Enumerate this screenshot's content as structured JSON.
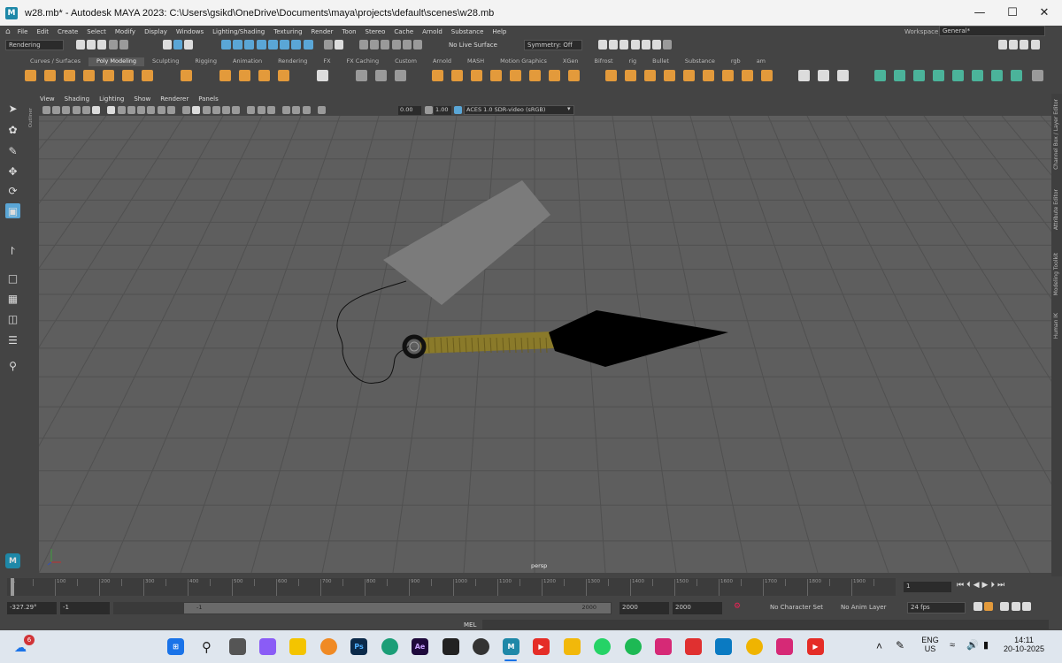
{
  "window": {
    "title": "w28.mb* - Autodesk MAYA 2023: C:\\Users\\gsikd\\OneDrive\\Documents\\maya\\projects\\default\\scenes\\w28.mb",
    "logo": "M"
  },
  "menubar": [
    "File",
    "Edit",
    "Create",
    "Select",
    "Modify",
    "Display",
    "Windows",
    "Lighting/Shading",
    "Texturing",
    "Render",
    "Toon",
    "Stereo",
    "Cache",
    "Arnold",
    "Substance",
    "Help"
  ],
  "workspace": {
    "label": "Workspace:",
    "value": "General*"
  },
  "statusline": {
    "menuset": "Rendering",
    "live_surface": "No Live Surface",
    "symmetry": "Symmetry: Off"
  },
  "shelf": {
    "tabs": [
      "Curves / Surfaces",
      "Poly Modeling",
      "Sculpting",
      "Rigging",
      "Animation",
      "Rendering",
      "FX",
      "FX Caching",
      "Custom",
      "Arnold",
      "MASH",
      "Motion Graphics",
      "XGen",
      "Bifrost",
      "rig",
      "Bullet",
      "Substance",
      "rgb",
      "am"
    ],
    "active": "Poly Modeling"
  },
  "panel": {
    "menus": [
      "View",
      "Shading",
      "Lighting",
      "Show",
      "Renderer",
      "Panels"
    ],
    "exposure": "0.00",
    "gamma": "1.00",
    "colorspace": "ACES 1.0 SDR-video (sRGB)",
    "camera_label": "persp"
  },
  "side_tabs": [
    "Channel Box / Layer Editor",
    "Attribute Editor",
    "Modeling Toolkit",
    "Human IK"
  ],
  "outliner_tab": "Outliner",
  "timeline": {
    "ticks": [
      "1",
      "50",
      "100",
      "150",
      "200",
      "250",
      "300",
      "350",
      "400",
      "450",
      "500",
      "550",
      "600",
      "650",
      "700",
      "750",
      "800",
      "850",
      "900",
      "950",
      "1000",
      "1050",
      "1100",
      "1150",
      "1200",
      "1250",
      "1300",
      "1350",
      "1400",
      "1450",
      "1500",
      "1550",
      "1600",
      "1650",
      "1700",
      "1750",
      "1800",
      "1850",
      "1900",
      "1950"
    ],
    "current_frame": "1"
  },
  "range": {
    "coord_field": "-327.29°",
    "start": "-1",
    "slider_start": "-1",
    "slider_end": "2000",
    "anim_end": "2000",
    "end": "2000",
    "character_set": "No Character Set",
    "anim_layer": "No Anim Layer",
    "fps": "24 fps"
  },
  "command_line": {
    "label": "MEL"
  },
  "taskbar": {
    "notification_count": "6",
    "apps": [
      "windows-start",
      "search",
      "task-view",
      "copilot",
      "sticky",
      "blender",
      "photoshop",
      "edge",
      "after-effects",
      "vscode",
      "chrome-alt",
      "maya",
      "youtube",
      "files",
      "whatsapp",
      "spotify",
      "instagram",
      "slack",
      "app-blue",
      "chrome",
      "instagram-2",
      "youtube-2"
    ],
    "ps_label": "Ps",
    "ae_label": "Ae",
    "lang": "ENG",
    "region": "US",
    "time": "14:11",
    "date": "20-10-2025"
  },
  "colors": {
    "accent": "#e39a3b",
    "viewport_bg": "#5e5e5e",
    "grid": "#4f4f4f",
    "blade": "#000000",
    "handle": "#8a7a2a"
  }
}
